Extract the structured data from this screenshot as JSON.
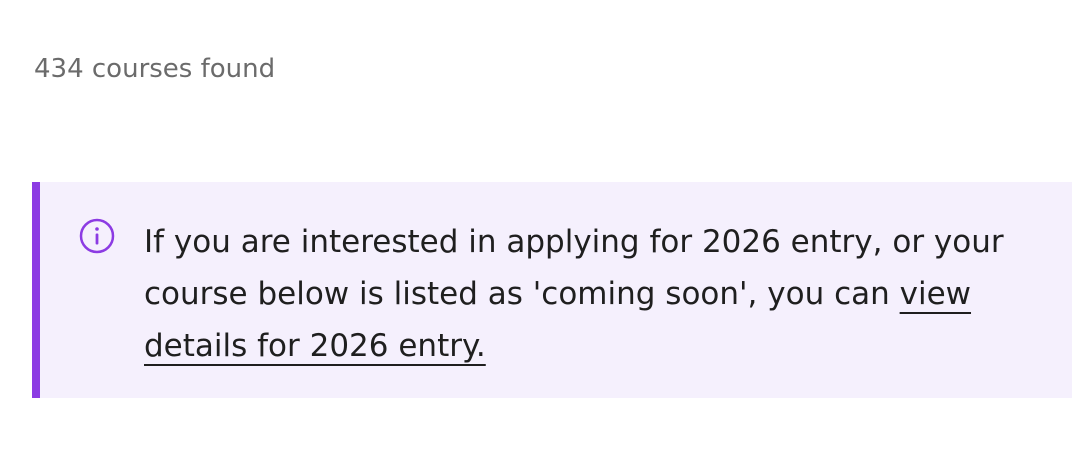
{
  "results": {
    "count_text": "434 courses found"
  },
  "notice": {
    "icon": "info-circle-icon",
    "accent_color": "#8c3be3",
    "background_color": "#f5f0fd",
    "text_before_link": "If you are interested in applying for 2026 entry, or your course below is listed as 'coming soon', you can ",
    "link_text": "view details for 2026 entry."
  }
}
